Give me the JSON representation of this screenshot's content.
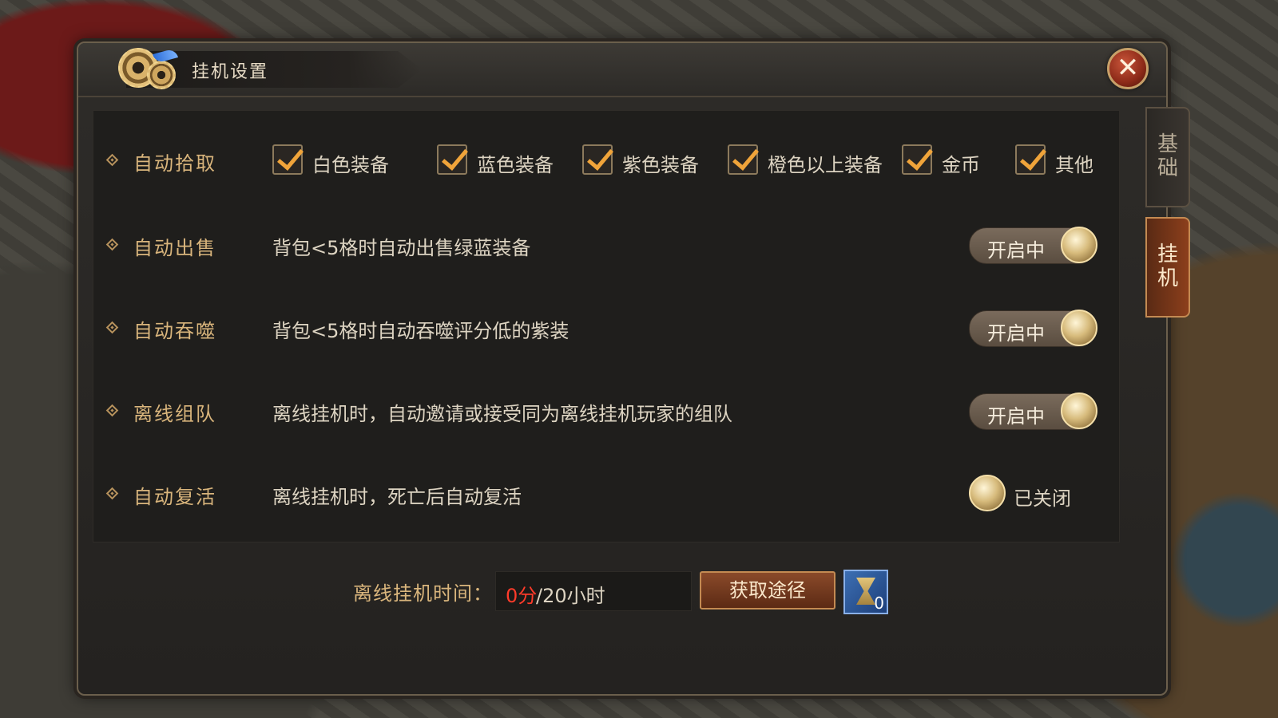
{
  "dialog": {
    "title": "挂机设置",
    "close_label": "✕"
  },
  "rows": [
    {
      "label": "自动拾取",
      "checkboxes": [
        {
          "label": "白色装备",
          "checked": true
        },
        {
          "label": "蓝色装备",
          "checked": true
        },
        {
          "label": "紫色装备",
          "checked": true
        },
        {
          "label": "橙色以上装备",
          "checked": true
        },
        {
          "label": "金币",
          "checked": true
        },
        {
          "label": "其他",
          "checked": true
        }
      ]
    },
    {
      "label": "自动出售",
      "desc": "背包<5格时自动出售绿蓝装备",
      "toggle": "开启中"
    },
    {
      "label": "自动吞噬",
      "desc": "背包<5格时自动吞噬评分低的紫装",
      "toggle": "开启中"
    },
    {
      "label": "离线组队",
      "desc": "离线挂机时，自动邀请或接受同为离线挂机玩家的组队",
      "toggle": "开启中"
    },
    {
      "label": "自动复活",
      "desc": "离线挂机时，死亡后自动复活",
      "toggle": "已关闭"
    }
  ],
  "offline": {
    "label": "离线挂机时间：",
    "current": "0分",
    "max": "/20小时",
    "button": "获取途径",
    "item_count": "0"
  },
  "side_tabs": [
    {
      "label": "基础",
      "active": false
    },
    {
      "label": "挂机",
      "active": true
    }
  ],
  "colors": {
    "accent_gold": "#d9b57c",
    "checkmark": "#f0a43a",
    "time_current": "#ff3b2a"
  }
}
